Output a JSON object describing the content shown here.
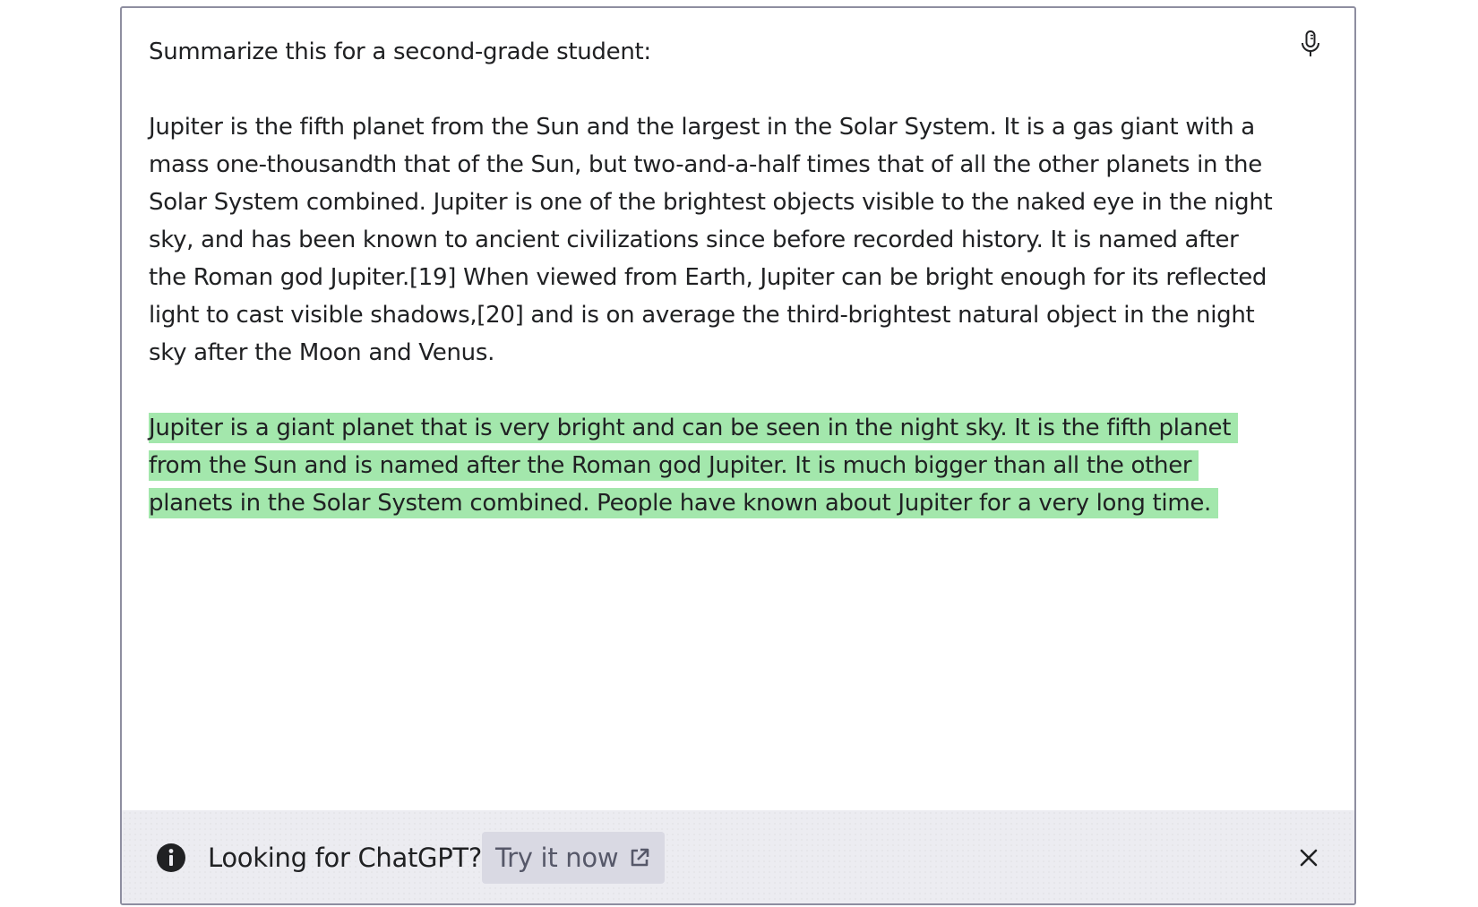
{
  "editor": {
    "prompt_line": "Summarize this for a second-grade student:",
    "source_paragraph": "Jupiter is the fifth planet from the Sun and the largest in the Solar System. It is a gas giant with a mass one-thousandth that of the Sun, but two-and-a-half times that of all the other planets in the Solar System combined. Jupiter is one of the brightest objects visible to the naked eye in the night sky, and has been known to ancient civilizations since before recorded history. It is named after the Roman god Jupiter.[19] When viewed from Earth, Jupiter can be bright enough for its reflected light to cast visible shadows,[20] and is on average the third-brightest natural object in the night sky after the Moon and Venus.",
    "completion": "Jupiter is a giant planet that is very bright and can be seen in the night sky. It is the fifth planet from the Sun and is named after the Roman god Jupiter. It is much bigger than all the other planets in the Solar System combined. People have known about Jupiter for a very long time.",
    "completion_highlight_color": "#a3e7ac",
    "mic_icon": "microphone-icon"
  },
  "banner": {
    "info_icon": "info-icon",
    "message": "Looking for ChatGPT?",
    "button_label": "Try it now",
    "button_icon": "external-link-icon",
    "close_icon": "close-icon"
  }
}
